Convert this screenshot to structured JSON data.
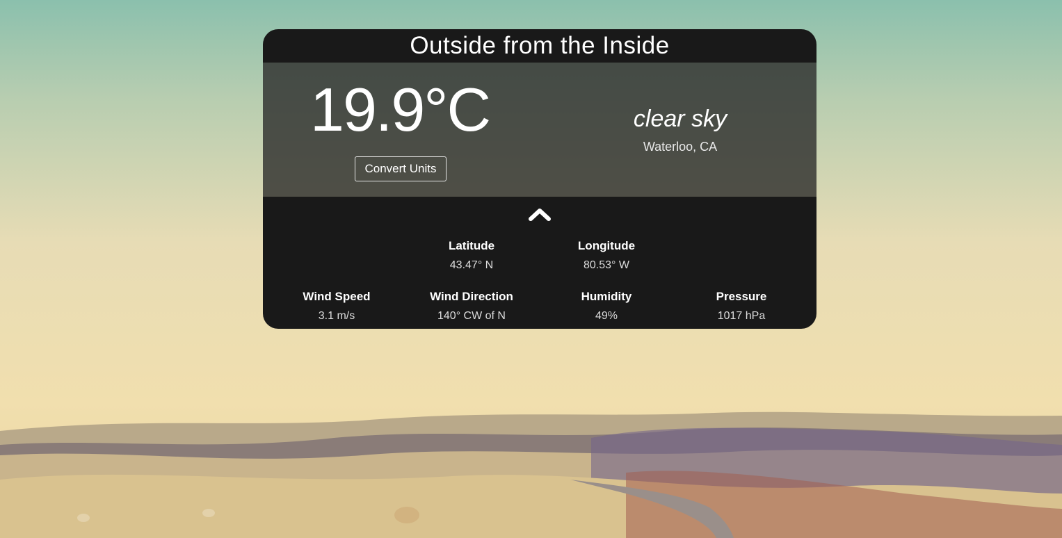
{
  "app": {
    "title": "Outside from the Inside"
  },
  "current": {
    "temperature": "19.9°C",
    "description": "clear sky",
    "location": "Waterloo, CA",
    "convert_label": "Convert Units"
  },
  "details": {
    "toggle_icon": "chevron-up-icon",
    "coords": [
      {
        "label": "Latitude",
        "value": "43.47° N"
      },
      {
        "label": "Longitude",
        "value": "80.53° W"
      }
    ],
    "stats": [
      {
        "label": "Wind Speed",
        "value": "3.1 m/s"
      },
      {
        "label": "Wind Direction",
        "value": "140° CW of N"
      },
      {
        "label": "Humidity",
        "value": "49%"
      },
      {
        "label": "Pressure",
        "value": "1017 hPa"
      }
    ]
  },
  "colors": {
    "card_dark": "#191919",
    "card_mid": "#3e423c",
    "text": "#ffffff"
  }
}
